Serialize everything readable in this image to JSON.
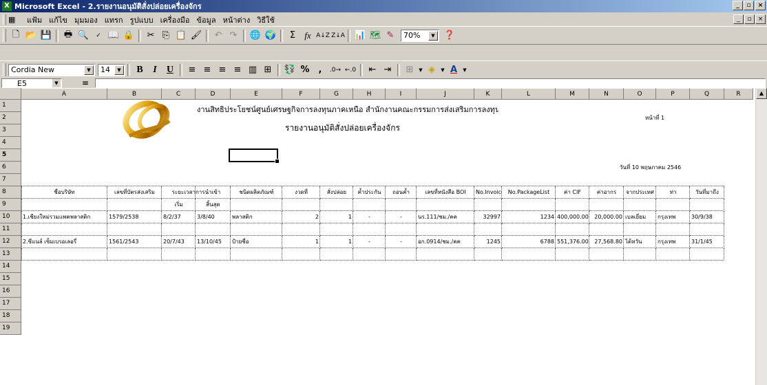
{
  "window": {
    "title": "Microsoft Excel - 2.รายงานอนุมัติสั่งปล่อยเครื่องจักร",
    "min": "_",
    "max": "▫",
    "close": "×"
  },
  "menu": {
    "items": [
      "แฟ้ม",
      "แก้ไข",
      "มุมมอง",
      "แทรก",
      "รูปแบบ",
      "เครื่องมือ",
      "ข้อมูล",
      "หน้าต่าง",
      "วิธีใช้"
    ]
  },
  "format_toolbar": {
    "font": "Cordia New",
    "size": "14",
    "zoom": "70%"
  },
  "formula_bar": {
    "name_box": "E5",
    "eq": "="
  },
  "columns": [
    "A",
    "B",
    "C",
    "D",
    "E",
    "F",
    "G",
    "H",
    "I",
    "J",
    "K",
    "L",
    "M",
    "N",
    "O",
    "P",
    "Q",
    "R"
  ],
  "rows": [
    "1",
    "2",
    "3",
    "4",
    "5",
    "6",
    "7",
    "8",
    "9",
    "10",
    "11",
    "12",
    "13",
    "14",
    "15",
    "16",
    "17",
    "18",
    "19"
  ],
  "sheet": {
    "line1": "งานสิทธิประโยชน์ศูนย์เศรษฐกิจการลงทุนภาคเหนือ สำนักงานคณะกรรมการส่งเสริมการลงทุน",
    "line2": "รายงานอนุมัติสั่งปล่อยเครื่องจักร",
    "page": "หน้าที่ 1",
    "date": "วันที่ 10 พฤษภาคม 2546",
    "headers": [
      "ชื่อบริษัท",
      "เลขที่บัตรส่งเสริม",
      "ระยะเวลาการนำเข้า",
      "",
      "ชนิดผลิตภัณฑ์",
      "งวดที่",
      "สั่งปล่อย",
      "ค้ำประกัน",
      "ถอนค้ำ",
      "เลขที่หนังสือ BOI",
      "No.Invoice",
      "No.PackageList",
      "ค่า CIF",
      "ค่าอากร",
      "จากประเทศ",
      "ท่า",
      "วันที่มาถึง"
    ],
    "sub_start": "เริ่ม",
    "sub_end": "สิ้นสุด",
    "row1": [
      "1.เชียงใหม่รวมแพคพลาสติก",
      "1579/2538",
      "8/2/37",
      "3/8/40",
      "พลาสติก",
      "2",
      "1",
      "-",
      "-",
      "นร.111/ชม./คค",
      "32997",
      "1234",
      "400,000.00",
      "20,000.00",
      "เบลเยี่ยม",
      "กรุงเทพ",
      "30/9/38"
    ],
    "row2": [
      "2.ซีแนล์ เซ็มเบรอเลอรี่",
      "1561/2543",
      "20/7/43",
      "13/10/45",
      "ป้ายชื่อ",
      "1",
      "1",
      "-",
      "-",
      "อก.0914/ชม./คค",
      "1245",
      "6788",
      "551,376.00",
      "27,568.80",
      "ไต้หวัน",
      "กรุงเทพ",
      "31/1/45"
    ]
  }
}
